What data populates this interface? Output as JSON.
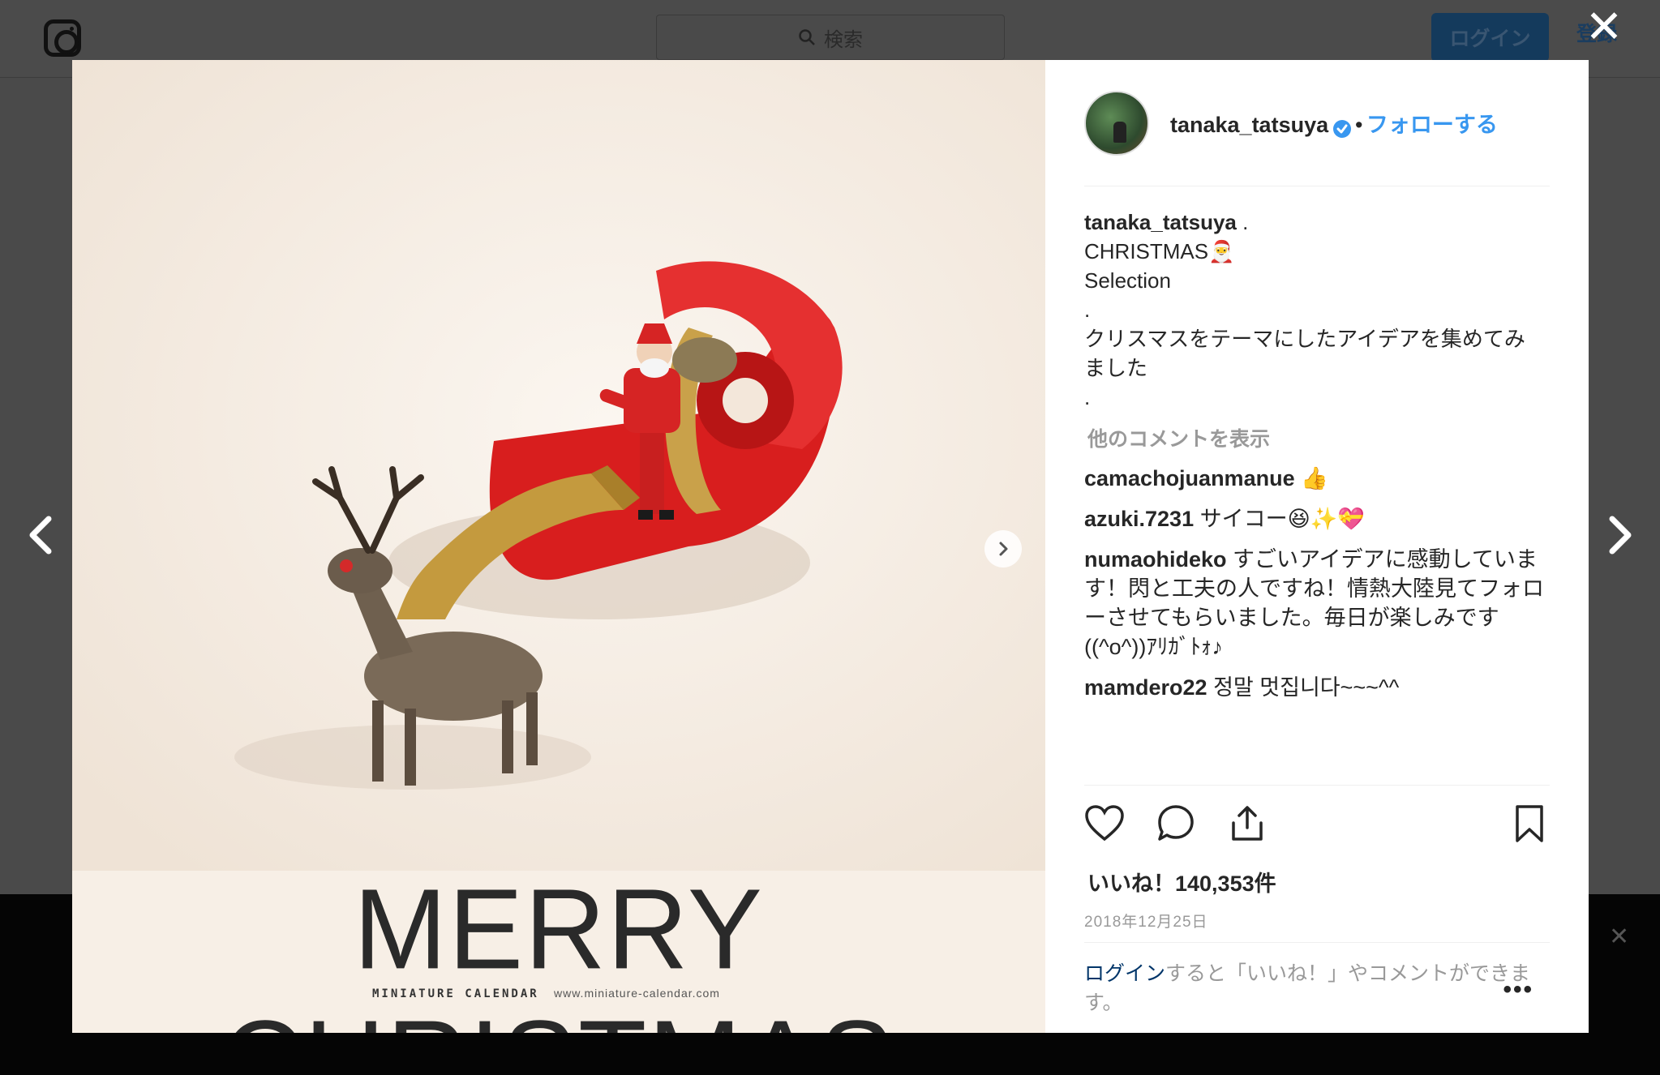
{
  "header": {
    "search_placeholder": "検索",
    "login_button": "ログイン",
    "signup_link": "登録"
  },
  "post": {
    "username": "tanaka_tatsuya",
    "follow_label": "フォローする",
    "image_title": "MERRY CHRISTMAS",
    "image_brand": "MINIATURE CALENDAR",
    "image_url": "www.miniature-calendar.com",
    "caption_user": "tanaka_tatsuya",
    "caption_lines": [
      ". ",
      "CHRISTMAS🎅",
      "Selection",
      ".",
      "クリスマスをテーマにしたアイデアを集めてみ",
      "ました",
      "."
    ],
    "more_comments": "他のコメントを表示",
    "comments": [
      {
        "user": "camachojuanmanue",
        "text": " 👍"
      },
      {
        "user": "azuki.7231",
        "text": " サイコー😆✨💝"
      },
      {
        "user": "numaohideko",
        "text": " すごいアイデアに感動しています！閃と工夫の人ですね！情熱大陸見てフォローさせてもらいました。毎日が楽しみです((^o^))ｱﾘｶﾞﾄｫ♪"
      },
      {
        "user": "mamdero22",
        "text": " 정말 멋집니다~~~^^"
      }
    ],
    "likes": "いいね！140,353件",
    "date": "2018年12月25日",
    "login_prompt_link": "ログイン",
    "login_prompt_text": "すると「いいね！」やコメントができます。",
    "more_options": "•••"
  },
  "colors": {
    "accent": "#3897f0",
    "text": "#262626",
    "muted": "#999999"
  }
}
